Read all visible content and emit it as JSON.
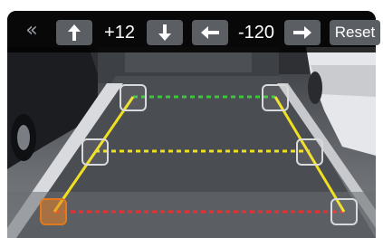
{
  "toolbar": {
    "collapse_icon": "double-chevron-left-icon",
    "vertical": {
      "up_icon": "arrow-up-icon",
      "value": "+12",
      "down_icon": "arrow-down-icon"
    },
    "horizontal": {
      "left_icon": "arrow-left-icon",
      "value": "-120",
      "right_icon": "arrow-right-icon"
    },
    "reset_label": "Reset"
  },
  "guide_lines": {
    "colors": {
      "near": "#e83030",
      "middle": "#f0e020",
      "far": "#3cc43c",
      "side": "#f0e020"
    }
  },
  "handles": {
    "active": "bottom-left",
    "colors": {
      "normal": "#d9dadc",
      "active": "#e07a1c"
    }
  }
}
